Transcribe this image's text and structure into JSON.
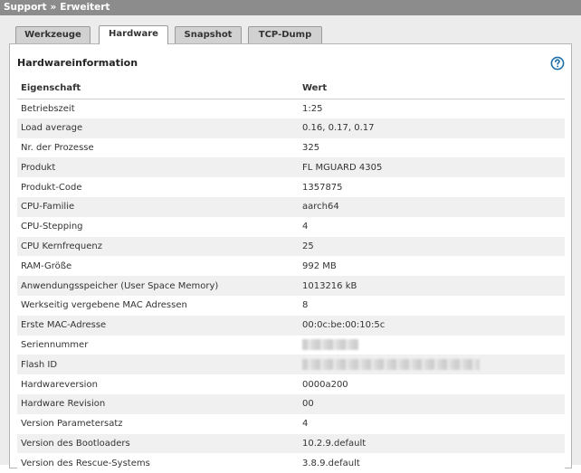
{
  "breadcrumb": {
    "level1": "Support",
    "separator": "»",
    "level2": "Erweitert"
  },
  "tabs": [
    {
      "label": "Werkzeuge",
      "active": false
    },
    {
      "label": "Hardware",
      "active": true
    },
    {
      "label": "Snapshot",
      "active": false
    },
    {
      "label": "TCP-Dump",
      "active": false
    }
  ],
  "panel": {
    "title": "Hardwareinformation",
    "help_icon": "question-circle-icon"
  },
  "table": {
    "headers": [
      "Eigenschaft",
      "Wert"
    ],
    "rows": [
      {
        "property": "Betriebszeit",
        "value": "1:25"
      },
      {
        "property": "Load average",
        "value": "0.16, 0.17, 0.17"
      },
      {
        "property": "Nr. der Prozesse",
        "value": "325"
      },
      {
        "property": "Produkt",
        "value": "FL MGUARD 4305"
      },
      {
        "property": "Produkt-Code",
        "value": "1357875"
      },
      {
        "property": "CPU-Familie",
        "value": "aarch64"
      },
      {
        "property": "CPU-Stepping",
        "value": "4"
      },
      {
        "property": "CPU Kernfrequenz",
        "value": "25"
      },
      {
        "property": "RAM-Größe",
        "value": "992 MB"
      },
      {
        "property": "Anwendungsspeicher (User Space Memory)",
        "value": "1013216 kB"
      },
      {
        "property": "Werkseitig vergebene MAC Adressen",
        "value": "8"
      },
      {
        "property": "Erste MAC-Adresse",
        "value": "00:0c:be:00:10:5c"
      },
      {
        "property": "Seriennummer",
        "value": "",
        "redacted": true
      },
      {
        "property": "Flash ID",
        "value": "",
        "redacted": true
      },
      {
        "property": "Hardwareversion",
        "value": "0000a200"
      },
      {
        "property": "Hardware Revision",
        "value": "00"
      },
      {
        "property": "Version Parametersatz",
        "value": "4"
      },
      {
        "property": "Version des Bootloaders",
        "value": "10.2.9.default"
      },
      {
        "property": "Version des Rescue-Systems",
        "value": "3.8.9.default"
      }
    ]
  },
  "colors": {
    "titlebar_bg": "#8c8c8c",
    "page_bg": "#ececec",
    "row_alt": "#f0f0f0",
    "help_icon": "#1e6fa8"
  }
}
